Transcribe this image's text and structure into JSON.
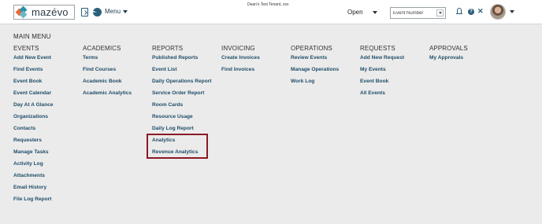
{
  "app": {
    "logo_text": "mazévo",
    "tenant": "Dean's Test Tenant, xxx",
    "menu_label": "Menu",
    "open_label": "Open",
    "search_placeholder": "Event Number"
  },
  "main_menu": {
    "title": "MAIN MENU",
    "columns": [
      {
        "heading": "EVENTS",
        "items": [
          "Add New Event",
          "Find Events",
          "Event Book",
          "Event Calendar",
          "Day At A Glance",
          "Organizations",
          "Contacts",
          "Requesters",
          "Manage Tasks",
          "Activity Log",
          "Attachments",
          "Email History",
          "File Log Report"
        ]
      },
      {
        "heading": "ACADEMICS",
        "items": [
          "Terms",
          "Find Courses",
          "Academic Book",
          "Academic Analytics"
        ]
      },
      {
        "heading": "REPORTS",
        "items": [
          "Published Reports",
          "Event List",
          "Daily Operations Report",
          "Service Order Report",
          "Room Cards",
          "Resource Usage",
          "Daily Log Report",
          "Analytics",
          "Revenue Analytics"
        ]
      },
      {
        "heading": "INVOICING",
        "items": [
          "Create Invoices",
          "Find Invoices"
        ]
      },
      {
        "heading": "OPERATIONS",
        "items": [
          "Review Events",
          "Manage Operations",
          "Work Log"
        ]
      },
      {
        "heading": "REQUESTS",
        "items": [
          "Add New Request",
          "My Events",
          "Event Book",
          "All Events"
        ]
      },
      {
        "heading": "APPROVALS",
        "items": [
          "My Approvals"
        ]
      }
    ]
  },
  "colors": {
    "link": "#1f4d69",
    "highlight_border": "#8a1a24",
    "background": "#ebebeb"
  }
}
